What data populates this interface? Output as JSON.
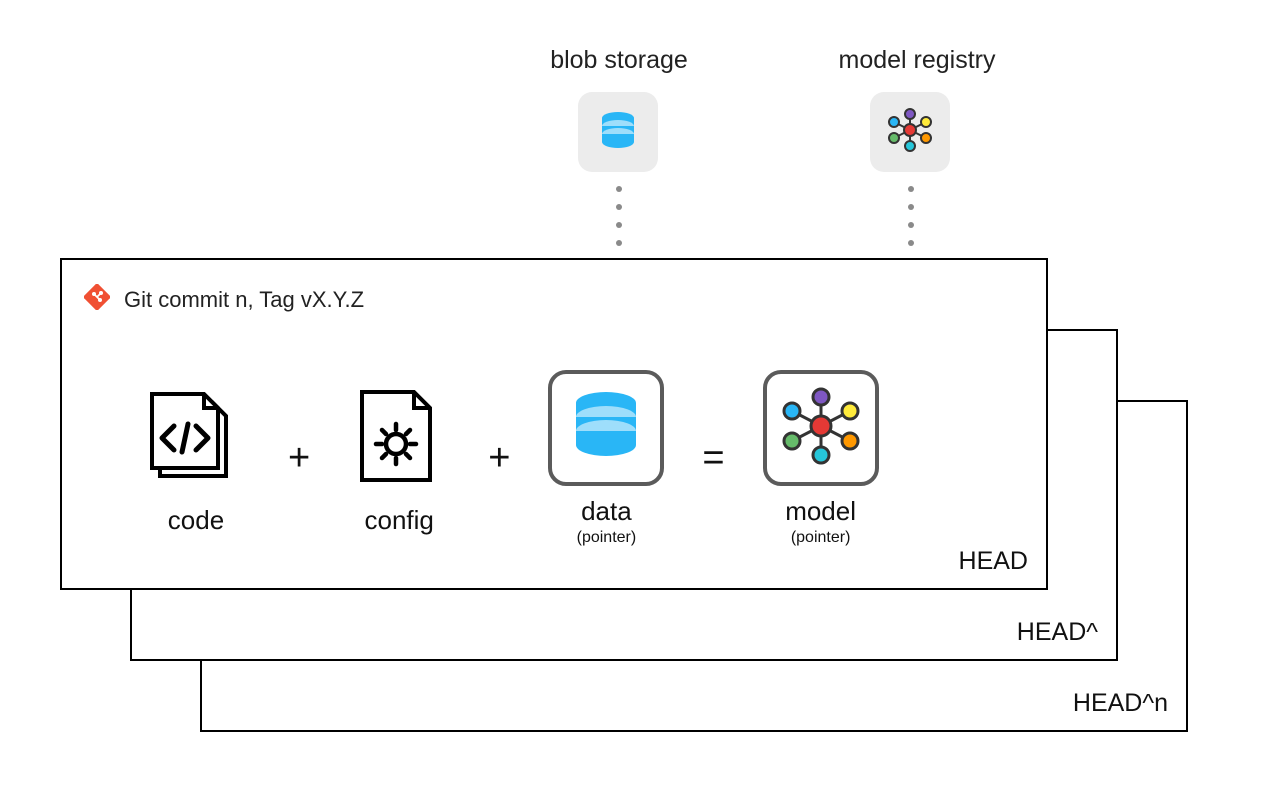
{
  "external": {
    "blob_label": "blob storage",
    "registry_label": "model registry"
  },
  "card": {
    "git_text": "Git commit n, Tag vX.Y.Z",
    "code_label": "code",
    "config_label": "config",
    "data_label": "data",
    "data_sub": "(pointer)",
    "model_label": "model",
    "model_sub": "(pointer)",
    "op_plus": "+",
    "op_eq": "="
  },
  "stack": {
    "head": "HEAD",
    "head1": "HEAD^",
    "headn": "HEAD^n"
  }
}
